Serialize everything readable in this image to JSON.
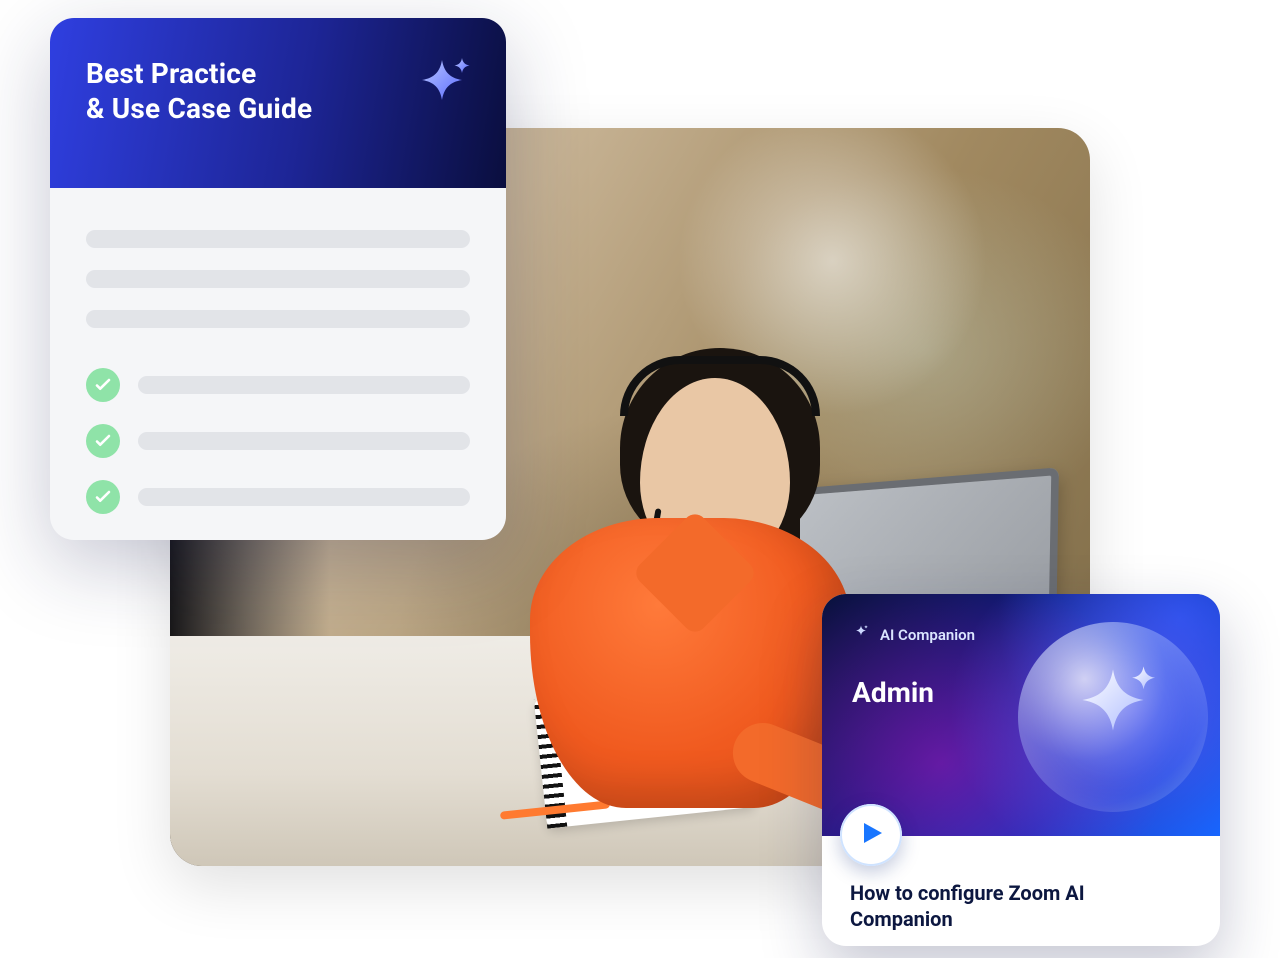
{
  "guide": {
    "title_line1": "Best Practice",
    "title_line2": "& Use Case Guide",
    "icon": "sparkle-icon",
    "checks": 3
  },
  "video": {
    "badge_label": "AI Companion",
    "section_label": "Admin",
    "caption": "How to configure Zoom AI Companion",
    "play_icon": "play-icon",
    "badge_icon": "sparkle-icon",
    "hero_icon": "sparkle-icon"
  },
  "colors": {
    "guide_grad_from": "#2f3fe0",
    "guide_grad_to": "#0a0e3e",
    "check_bg": "#8fe3a8",
    "placeholder": "#e2e4e8",
    "play_accent": "#1976ff"
  }
}
